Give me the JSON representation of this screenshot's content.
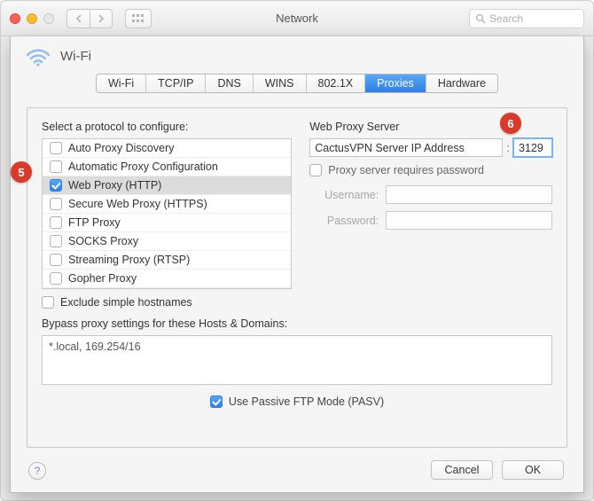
{
  "window": {
    "title": "Network",
    "search_placeholder": "Search"
  },
  "interface": {
    "name": "Wi-Fi"
  },
  "tabs": [
    "Wi-Fi",
    "TCP/IP",
    "DNS",
    "WINS",
    "802.1X",
    "Proxies",
    "Hardware"
  ],
  "active_tab_index": 5,
  "protocols_label": "Select a protocol to configure:",
  "protocols": [
    {
      "label": "Auto Proxy Discovery",
      "checked": false
    },
    {
      "label": "Automatic Proxy Configuration",
      "checked": false
    },
    {
      "label": "Web Proxy (HTTP)",
      "checked": true,
      "selected": true
    },
    {
      "label": "Secure Web Proxy (HTTPS)",
      "checked": false
    },
    {
      "label": "FTP Proxy",
      "checked": false
    },
    {
      "label": "SOCKS Proxy",
      "checked": false
    },
    {
      "label": "Streaming Proxy (RTSP)",
      "checked": false
    },
    {
      "label": "Gopher Proxy",
      "checked": false
    }
  ],
  "exclude_label": "Exclude simple hostnames",
  "server": {
    "heading": "Web Proxy Server",
    "host": "CactusVPN Server IP Address",
    "port": "3129",
    "requires_password_label": "Proxy server requires password",
    "username_label": "Username:",
    "password_label": "Password:",
    "username": "",
    "password": ""
  },
  "bypass": {
    "label": "Bypass proxy settings for these Hosts & Domains:",
    "value": "*.local, 169.254/16"
  },
  "pasv_label": "Use Passive FTP Mode (PASV)",
  "buttons": {
    "cancel": "Cancel",
    "ok": "OK"
  },
  "callouts": {
    "five": "5",
    "six": "6"
  }
}
